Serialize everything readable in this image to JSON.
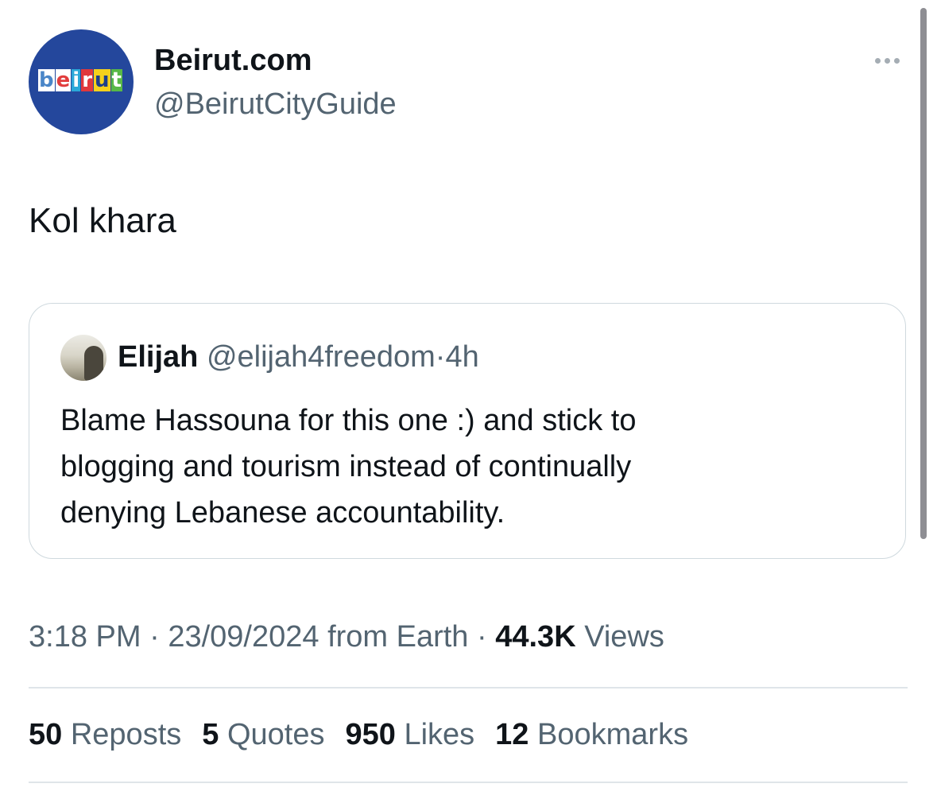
{
  "tweet": {
    "author": {
      "display_name": "Beirut.com",
      "handle": "@BeirutCityGuide",
      "avatar_letters": [
        {
          "char": "b",
          "color": "#4a86c8",
          "bg": "#ffffff"
        },
        {
          "char": "e",
          "color": "#e23d3d",
          "bg": "#ffffff"
        },
        {
          "char": "i",
          "color": "#ffffff",
          "bg": "#2aa8d8"
        },
        {
          "char": "r",
          "color": "#ffffff",
          "bg": "#e0383d"
        },
        {
          "char": "u",
          "color": "#1d3f8a",
          "bg": "#f5d11c"
        },
        {
          "char": "t",
          "color": "#ffffff",
          "bg": "#58b847"
        }
      ],
      "avatar_bg": "#24479c"
    },
    "more_icon": "ellipsis-icon",
    "text": "Kol khara",
    "quoted": {
      "display_name": "Elijah",
      "handle": "@elijah4freedom",
      "separator": "·",
      "age": "4h",
      "lines": [
        "Blame Hassouna for this one :) and stick to",
        "blogging and tourism instead of continually",
        "denying Lebanese accountability."
      ]
    },
    "meta": {
      "time": "3:18 PM",
      "separator": "·",
      "date": "23/09/2024",
      "source": "from Earth",
      "views_count": "44.3K",
      "views_label": "Views"
    },
    "stats": [
      {
        "count": "50",
        "label": "Reposts"
      },
      {
        "count": "5",
        "label": "Quotes"
      },
      {
        "count": "950",
        "label": "Likes"
      },
      {
        "count": "12",
        "label": "Bookmarks"
      }
    ]
  },
  "colors": {
    "primary_text": "#0f1419",
    "secondary_text": "#536471",
    "border": "#cfd9de",
    "divider": "#dfe5e9"
  }
}
